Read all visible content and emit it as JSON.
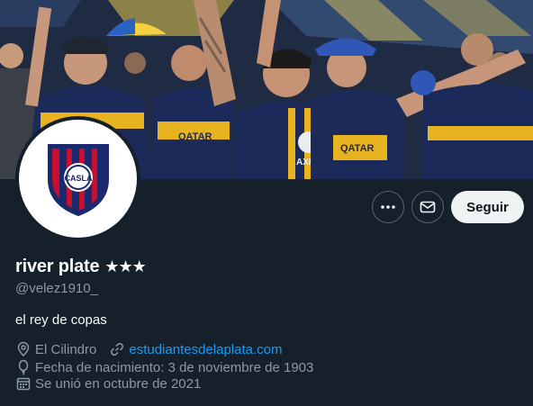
{
  "profile": {
    "display_name": "river plate",
    "name_suffix": "★★★",
    "handle": "@velez1910_",
    "bio": "el rey de copas",
    "location": "El Cilindro",
    "website": "estudiantesdelaplata.com",
    "birth": "Fecha de nacimiento: 3 de noviembre de 1903",
    "joined": "Se unió en octubre de 2021"
  },
  "banner": {
    "jersey_sponsor_1": "QATAR AIRWAYS",
    "jersey_sponsor_2": "QATAR AIRWAYS",
    "sleeve_text": "AXION"
  },
  "avatar": {
    "logo_text": "CASLA"
  },
  "actions": {
    "more_icon": "more-dots-icon",
    "message_icon": "envelope-icon",
    "follow_label": "Seguir"
  },
  "colors": {
    "background": "#15202b",
    "accent_link": "#1d9bf0",
    "secondary_text": "#8b98a5",
    "follow_bg": "#eff3f4",
    "jersey_blue": "#1c2a5a",
    "jersey_gold": "#e8b321",
    "crest_red": "#c8102e",
    "crest_blue": "#1b2a6e"
  }
}
